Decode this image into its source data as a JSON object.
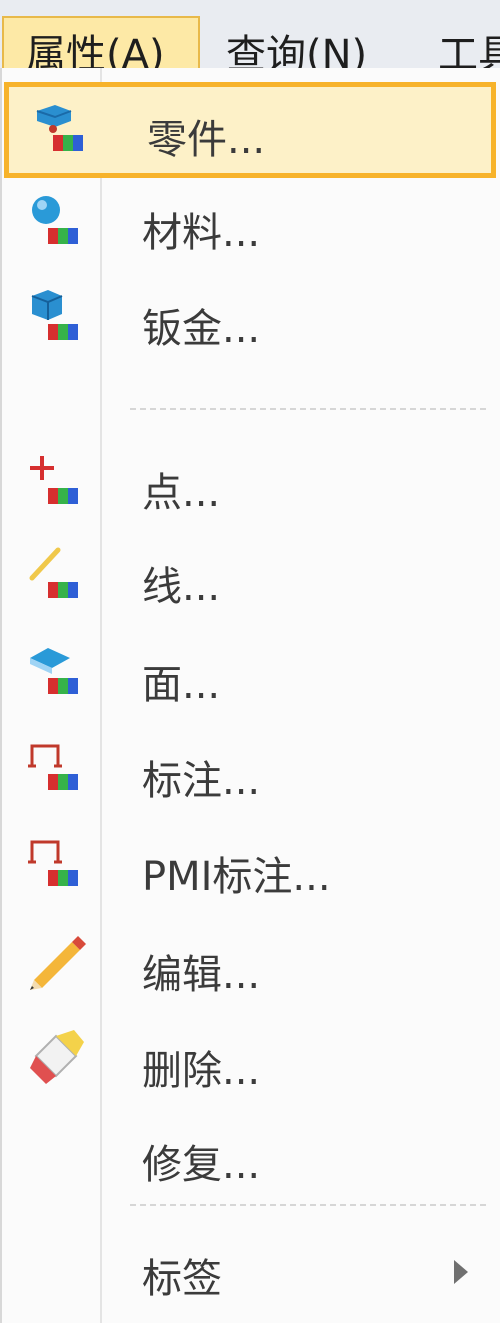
{
  "menubar": {
    "items": [
      "属性(A)",
      "查询(N)",
      "工具"
    ]
  },
  "menu": {
    "items": [
      {
        "label": "零件...",
        "icon": "part-properties-icon"
      },
      {
        "label": "材料...",
        "icon": "material-properties-icon"
      },
      {
        "label": "钣金...",
        "icon": "sheet-metal-properties-icon"
      },
      {
        "label": "点...",
        "icon": "point-properties-icon"
      },
      {
        "label": "线...",
        "icon": "line-properties-icon"
      },
      {
        "label": "面...",
        "icon": "face-properties-icon"
      },
      {
        "label": "标注...",
        "icon": "annotation-properties-icon"
      },
      {
        "label": "PMI标注...",
        "icon": "pmi-annotation-properties-icon"
      },
      {
        "label": "编辑...",
        "icon": "pencil-icon"
      },
      {
        "label": "删除...",
        "icon": "eraser-icon"
      },
      {
        "label": "修复...",
        "icon": ""
      },
      {
        "label": "标签",
        "icon": ""
      }
    ]
  },
  "colors": {
    "highlight_border": "#f7b32b",
    "highlight_fill": "#fdf1c8",
    "active_menubar": "#fde9a6"
  }
}
